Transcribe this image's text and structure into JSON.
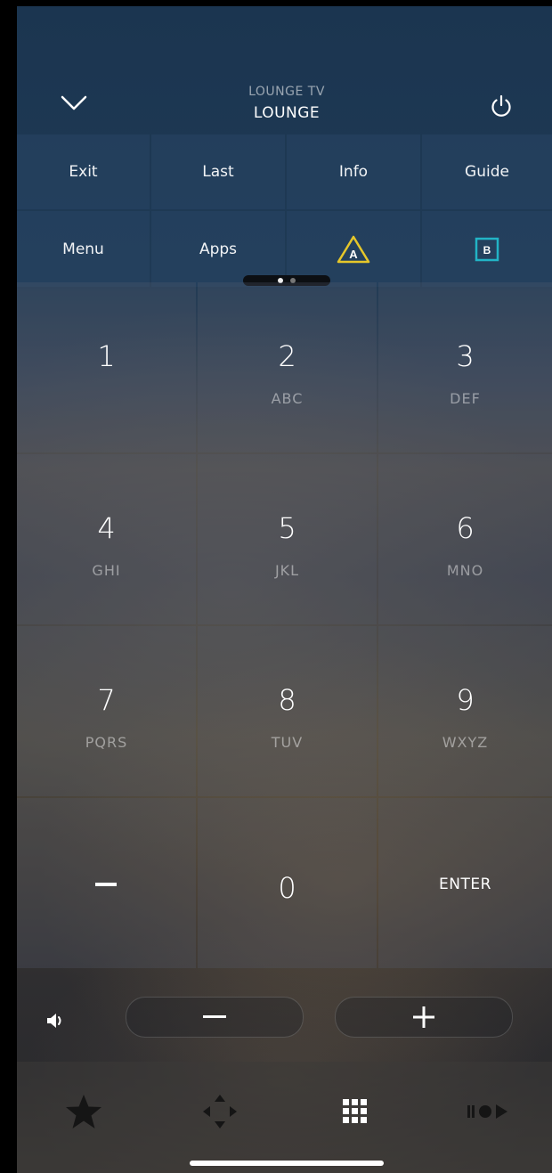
{
  "header": {
    "device": "LOUNGE TV",
    "room": "LOUNGE"
  },
  "quick_buttons": {
    "row1": [
      "Exit",
      "Last",
      "Info",
      "Guide"
    ],
    "row2": [
      "Menu",
      "Apps"
    ],
    "color_a_label": "A",
    "color_b_label": "B",
    "color_a_color": "#e6c72a",
    "color_b_color": "#22b4c6"
  },
  "pager": {
    "pages": 2,
    "current": 1
  },
  "keypad": {
    "keys": [
      {
        "num": "1",
        "letters": ""
      },
      {
        "num": "2",
        "letters": "ABC"
      },
      {
        "num": "3",
        "letters": "DEF"
      },
      {
        "num": "4",
        "letters": "GHI"
      },
      {
        "num": "5",
        "letters": "JKL"
      },
      {
        "num": "6",
        "letters": "MNO"
      },
      {
        "num": "7",
        "letters": "PQRS"
      },
      {
        "num": "8",
        "letters": "TUV"
      },
      {
        "num": "9",
        "letters": "WXYZ"
      },
      {
        "num": "0",
        "letters": ""
      }
    ],
    "enter_label": "ENTER"
  },
  "volume": {
    "icon": "speaker-icon",
    "minus_icon": "minus-icon",
    "plus_icon": "plus-icon"
  },
  "tabs": [
    "star-icon",
    "dpad-icon",
    "keypad-grid-icon",
    "transport-icon"
  ]
}
